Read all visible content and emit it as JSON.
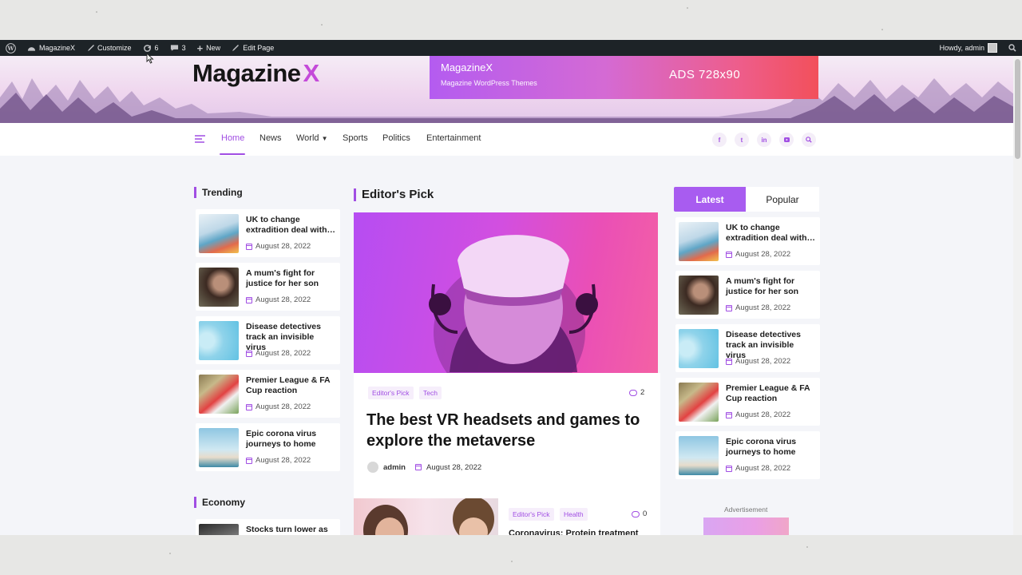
{
  "adminbar": {
    "site_name": "MagazineX",
    "customize": "Customize",
    "updates_count": "6",
    "comments_count": "3",
    "new": "New",
    "edit_page": "Edit Page",
    "howdy": "Howdy, admin"
  },
  "header": {
    "logo_text": "Magazine",
    "logo_x": "X",
    "ad": {
      "name": "MagazineX",
      "subtitle": "Magazine WordPress Themes",
      "size": "ADS 728x90"
    }
  },
  "nav": {
    "items": [
      {
        "label": "Home",
        "active": true
      },
      {
        "label": "News"
      },
      {
        "label": "World"
      },
      {
        "label": "Sports"
      },
      {
        "label": "Politics"
      },
      {
        "label": "Entertainment"
      }
    ],
    "social": [
      "f",
      "t",
      "in",
      "yt"
    ]
  },
  "trending": {
    "title": "Trending",
    "items": [
      {
        "title": "UK to change extradition deal with…",
        "date": "August 28, 2022"
      },
      {
        "title": "A mum's fight for justice for her son",
        "date": "August 28, 2022"
      },
      {
        "title": "Disease detectives track an invisible virus",
        "date": "August 28, 2022"
      },
      {
        "title": "Premier League & FA Cup reaction",
        "date": "August 28, 2022"
      },
      {
        "title": "Epic corona virus journeys to home",
        "date": "August 28, 2022"
      }
    ]
  },
  "economy": {
    "title": "Economy",
    "first_item": "Stocks turn lower as"
  },
  "editors_pick": {
    "title": "Editor's Pick",
    "feature": {
      "tags": [
        "Editor's Pick",
        "Tech"
      ],
      "comments": "2",
      "title": "The best VR headsets and games to explore the metaverse",
      "author": "admin",
      "date": "August 28, 2022"
    },
    "second": {
      "tags": [
        "Editor's Pick",
        "Health"
      ],
      "comments": "0",
      "title": "Coronavirus: Protein treatment"
    }
  },
  "sidebar": {
    "tabs": [
      "Latest",
      "Popular"
    ],
    "items": [
      {
        "title": "UK to change extradition deal with…",
        "date": "August 28, 2022"
      },
      {
        "title": "A mum's fight for justice for her son",
        "date": "August 28, 2022"
      },
      {
        "title": "Disease detectives track an invisible virus",
        "date": "August 28, 2022"
      },
      {
        "title": "Premier League & FA Cup reaction",
        "date": "August 28, 2022"
      },
      {
        "title": "Epic corona virus journeys to home",
        "date": "August 28, 2022"
      }
    ],
    "advertisement_label": "Advertisement"
  },
  "colors": {
    "accent": "#a14ee3",
    "adminbar": "#1d2327"
  }
}
